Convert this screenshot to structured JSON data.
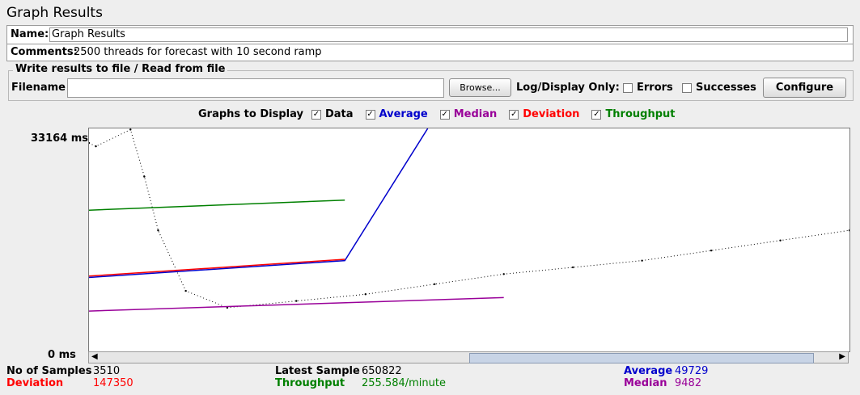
{
  "window": {
    "title": "Graph Results"
  },
  "name": {
    "label": "Name:",
    "value": "Graph Results"
  },
  "comments": {
    "label": "Comments:",
    "value": "2500 threads for forecast with 10 second ramp"
  },
  "file_panel": {
    "legend": "Write results to file / Read from file",
    "filename_label": "Filename",
    "filename_value": "",
    "browse_label": "Browse...",
    "log_display_label": "Log/Display Only:",
    "errors_label": "Errors",
    "successes_label": "Successes",
    "configure_label": "Configure"
  },
  "graphs_to_display": {
    "label": "Graphs to Display",
    "items": [
      {
        "label": "Data",
        "checked": true,
        "color": "#000000"
      },
      {
        "label": "Average",
        "checked": true,
        "color": "#0000cc"
      },
      {
        "label": "Median",
        "checked": true,
        "color": "#990099"
      },
      {
        "label": "Deviation",
        "checked": true,
        "color": "#ff0000"
      },
      {
        "label": "Throughput",
        "checked": true,
        "color": "#008000"
      }
    ]
  },
  "graph": {
    "y_max_label": "33164  ms",
    "y_min_label": "0  ms"
  },
  "chart_data": {
    "type": "line",
    "ylim": [
      0,
      33164
    ],
    "y_unit": "ms",
    "series": [
      {
        "name": "Data",
        "color": "#000000",
        "points": [
          [
            0,
            31000
          ],
          [
            10,
            30500
          ],
          [
            60,
            33000
          ],
          [
            80,
            26000
          ],
          [
            100,
            18000
          ],
          [
            140,
            9000
          ],
          [
            200,
            6500
          ],
          [
            300,
            7500
          ],
          [
            400,
            8500
          ],
          [
            500,
            10000
          ],
          [
            600,
            11500
          ],
          [
            700,
            12500
          ],
          [
            800,
            13500
          ],
          [
            900,
            15000
          ],
          [
            1000,
            16500
          ],
          [
            1100,
            18000
          ]
        ]
      },
      {
        "name": "Average",
        "color": "#0000cc",
        "points": [
          [
            0,
            11000
          ],
          [
            370,
            13500
          ],
          [
            490,
            33164
          ]
        ]
      },
      {
        "name": "Median",
        "color": "#990099",
        "points": [
          [
            0,
            6000
          ],
          [
            600,
            8000
          ]
        ]
      },
      {
        "name": "Deviation",
        "color": "#ff0000",
        "points": [
          [
            0,
            11200
          ],
          [
            370,
            13700
          ]
        ]
      },
      {
        "name": "Throughput",
        "color": "#008000",
        "points": [
          [
            0,
            21000
          ],
          [
            370,
            22500
          ]
        ]
      }
    ]
  },
  "stats": {
    "samples_label": "No of Samples",
    "samples_value": "3510",
    "deviation_label": "Deviation",
    "deviation_value": "147350",
    "latest_label": "Latest Sample",
    "latest_value": "650822",
    "throughput_label": "Throughput",
    "throughput_value": "255.584/minute",
    "average_label": "Average",
    "average_value": "49729",
    "median_label": "Median",
    "median_value": "9482"
  },
  "icons": {
    "left_arrow": "scroll-left-icon",
    "right_arrow": "scroll-right-icon"
  }
}
